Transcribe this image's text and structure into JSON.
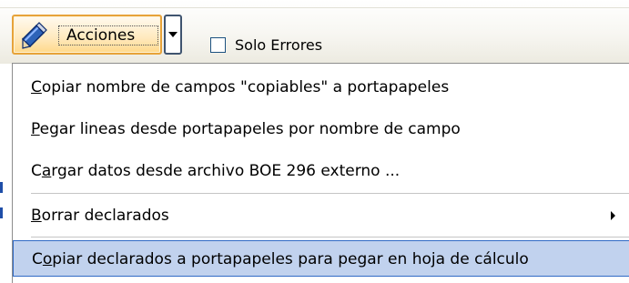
{
  "toolbar": {
    "acciones_label": "Acciones",
    "acciones_icon": "pencil-icon",
    "dropdown_icon": "chevron-down-icon",
    "checkbox_label": "Solo Errores",
    "checkbox_checked": false
  },
  "menu": {
    "items": [
      {
        "pre": "",
        "key": "C",
        "post": "opiar nombre de campos \"copiables\" a portapapeles"
      },
      {
        "pre": "",
        "key": "P",
        "post": "egar lineas desde portapapeles por nombre de campo"
      },
      {
        "pre": "C",
        "key": "a",
        "post": "rgar datos desde archivo BOE 296 externo ..."
      },
      {
        "pre": "",
        "key": "B",
        "post": "orrar declarados",
        "submenu": true
      },
      {
        "pre": "C",
        "key": "o",
        "post": "piar declarados a portapapeles para pegar en hoja de cálculo",
        "highlighted": true
      }
    ]
  },
  "colors": {
    "highlight_bg": "#c1d2ee",
    "highlight_border": "#316ac5",
    "button_border": "#e7a33a"
  }
}
